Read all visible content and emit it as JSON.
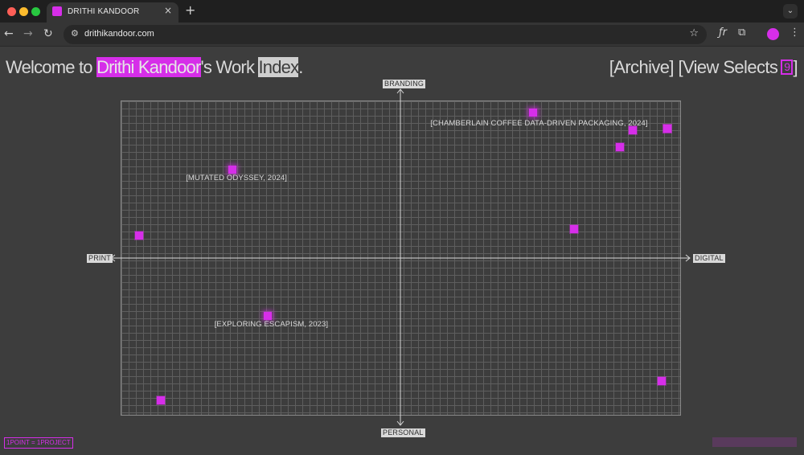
{
  "browser": {
    "tab_title": "DRITHI KANDOOR",
    "tab_close": "×",
    "new_tab": "+",
    "url": "drithikandoor.com",
    "back": "←",
    "forward": "→",
    "reload": "↻",
    "star": "☆",
    "ext1": "ƒr",
    "ext2": "⧉",
    "more": "⋮",
    "tab_menu": "⌄",
    "tune": "⚙"
  },
  "header": {
    "welcome_pre": "Welcome to ",
    "name": "Drithi Kandoor",
    "welcome_mid": "'s Work ",
    "index": "Index",
    "welcome_end": ".",
    "archive": "[Archive]",
    "view_selects": "[View Selects",
    "selects_count": "9",
    "closing": "]"
  },
  "chart_data": {
    "type": "scatter",
    "axes": {
      "top": "BRANDING",
      "bottom": "PERSONAL",
      "left": "PRINT",
      "right": "DIGITAL"
    },
    "xlim": [
      -1,
      1
    ],
    "ylim": [
      -1,
      1
    ],
    "grid": true,
    "points": [
      {
        "x": 0.955,
        "y": 0.82
      },
      {
        "x": 0.955,
        "y": 0.82
      },
      {
        "x": 0.475,
        "y": 0.925,
        "label": "[CHAMBERLAIN COFFEE DATA-DRIVEN PACKAGING, 2024]"
      },
      {
        "x": 0.785,
        "y": 0.705
      },
      {
        "x": 0.83,
        "y": 0.81
      },
      {
        "x": 0.62,
        "y": 0.185
      },
      {
        "x": -0.6,
        "y": 0.56,
        "label": "[MUTATED ODYSSEY, 2024]"
      },
      {
        "x": -0.935,
        "y": 0.145
      },
      {
        "x": -0.475,
        "y": -0.365,
        "label": "[EXPLORING ESCAPISM, 2023]"
      },
      {
        "x": -0.855,
        "y": -0.905
      },
      {
        "x": 0.935,
        "y": -0.78
      }
    ]
  },
  "legend": "1POINT = 1PROJECT",
  "colors": {
    "accent": "#d62ee9",
    "background": "#3d3d3d",
    "text": "#d9d9d9"
  }
}
